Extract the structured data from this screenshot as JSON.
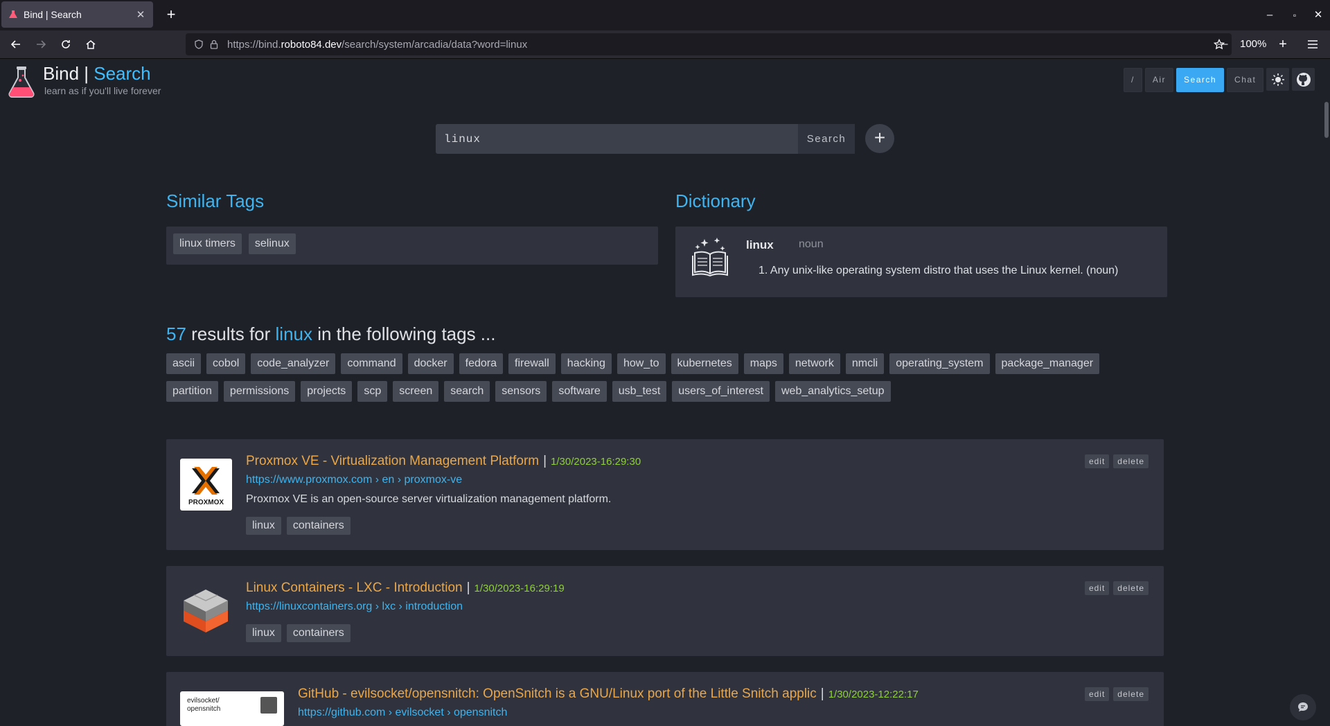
{
  "browser": {
    "tab_title": "Bind | Search",
    "tab_close": "✕",
    "new_tab": "+",
    "url_prefix": "https://bind.",
    "url_host": "roboto84.dev",
    "url_path": "/search/system/arcadia/data?word=linux",
    "zoom": "100%",
    "zoom_out": "—",
    "zoom_in": "+",
    "win_min": "–",
    "win_max": "▫",
    "win_close": "✕"
  },
  "header": {
    "brand": "Bind",
    "brand_sep": " | ",
    "brand_accent": "Search",
    "tagline": "learn as if you'll live forever",
    "nav": [
      "/",
      "Air",
      "Search",
      "Chat"
    ]
  },
  "search": {
    "value": "linux",
    "button": "Search",
    "add": "+"
  },
  "similar_tags": {
    "title": "Similar Tags",
    "tags": [
      "linux timers",
      "selinux"
    ]
  },
  "dictionary": {
    "title": "Dictionary",
    "word": "linux",
    "pos": "noun",
    "definition": "1. Any unix-like operating system distro that uses the Linux kernel. (noun)"
  },
  "results": {
    "count": "57",
    "text1": " results for ",
    "word": "linux",
    "text2": " in the following tags ...",
    "tags_row1": [
      "ascii",
      "cobol",
      "code_analyzer",
      "command",
      "docker",
      "fedora",
      "firewall",
      "hacking",
      "how_to",
      "kubernetes",
      "maps",
      "network",
      "nmcli",
      "operating_system",
      "package_manager"
    ],
    "tags_row2": [
      "partition",
      "permissions",
      "projects",
      "scp",
      "screen",
      "search",
      "sensors",
      "software",
      "usb_test",
      "users_of_interest",
      "web_analytics_setup"
    ],
    "items": [
      {
        "title": "Proxmox VE - Virtualization Management Platform",
        "timestamp": "1/30/2023-16:29:30",
        "url": "https://www.proxmox.com › en › proxmox-ve",
        "description": "Proxmox VE is an open-source server virtualization management platform.",
        "tags": [
          "linux",
          "containers"
        ],
        "thumb_text": "PROXMOX"
      },
      {
        "title": "Linux Containers - LXC - Introduction",
        "timestamp": "1/30/2023-16:29:19",
        "url": "https://linuxcontainers.org › lxc › introduction",
        "tags": [
          "linux",
          "containers"
        ]
      },
      {
        "title": "GitHub - evilsocket/opensnitch: OpenSnitch is a GNU/Linux port of the Little Snitch applic",
        "timestamp": "1/30/2023-12:22:17",
        "url": "https://github.com › evilsocket › opensnitch",
        "thumb_text": "evilsocket/ opensnitch"
      }
    ],
    "edit": "edit",
    "delete": "delete"
  },
  "colors": {
    "accent": "#3fb4ef",
    "title": "#e9a74a",
    "timestamp": "#8fcf3a",
    "background": "#1f2129",
    "panel": "#30333d"
  }
}
